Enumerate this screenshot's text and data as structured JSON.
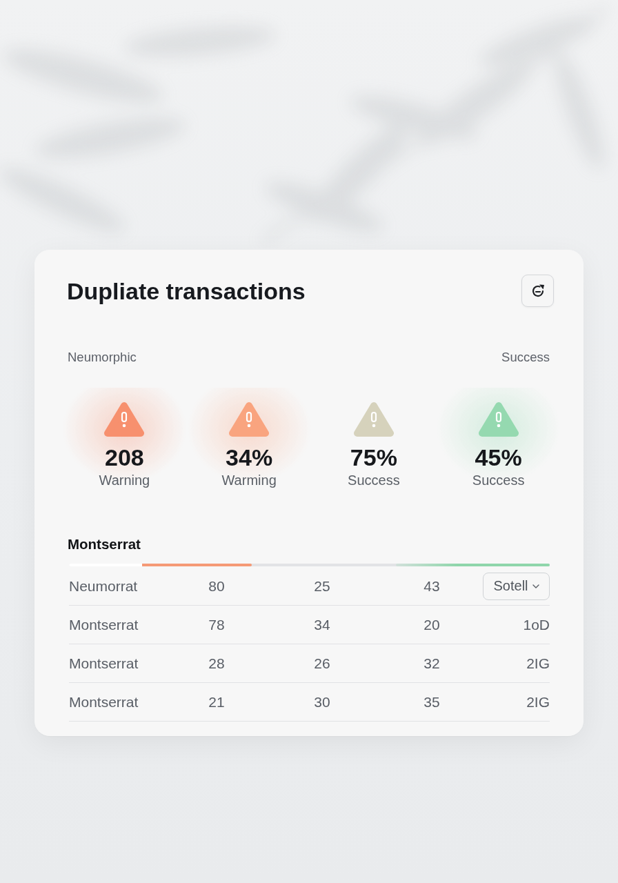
{
  "card": {
    "title": "Dupliate transactions"
  },
  "labels": {
    "left": "Neumorphic",
    "right": "Success"
  },
  "metrics": [
    {
      "value": "208",
      "label": "Warning",
      "color": "#f7906e",
      "glow": true
    },
    {
      "value": "34%",
      "label": "Warming",
      "color": "#f9a47f",
      "glow": true
    },
    {
      "value": "75%",
      "label": "Success",
      "color": "#d6d2bc",
      "glow": false
    },
    {
      "value": "45%",
      "label": "Success",
      "color": "#95d9b0",
      "glow": true
    }
  ],
  "section": {
    "title": "Montserrat"
  },
  "progress": [
    {
      "kind": "start",
      "level": 0.38,
      "color": "#f59a76"
    },
    {
      "kind": "end",
      "level": 0.32,
      "color": "#8fd6ab"
    }
  ],
  "table": {
    "rows": [
      {
        "name": "Neumorrat",
        "values": [
          "80",
          "25",
          "43"
        ],
        "end": {
          "kind": "dropdown",
          "text": "Sotell"
        }
      },
      {
        "name": "Montserrat",
        "values": [
          "78",
          "34",
          "20"
        ],
        "end": {
          "kind": "text",
          "text": "1oD"
        }
      },
      {
        "name": "Montserrat",
        "values": [
          "28",
          "26",
          "32"
        ],
        "end": {
          "kind": "text",
          "text": "2IG"
        }
      },
      {
        "name": "Montserrat",
        "values": [
          "21",
          "30",
          "35"
        ],
        "end": {
          "kind": "text",
          "text": "2IG"
        }
      }
    ]
  }
}
